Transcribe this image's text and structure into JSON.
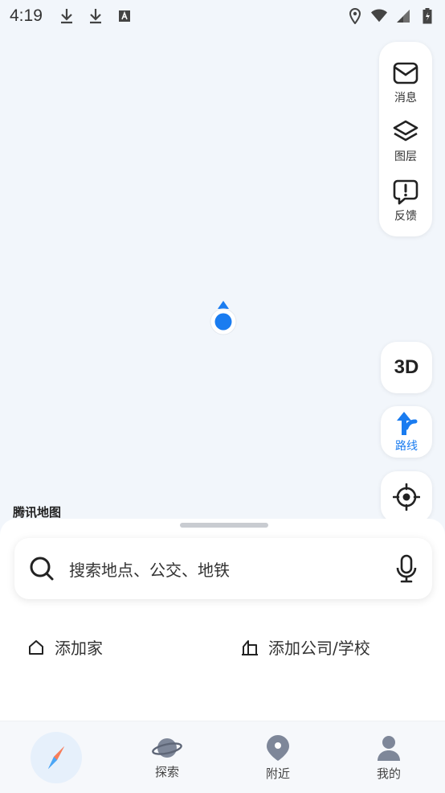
{
  "status_bar": {
    "time": "4:19"
  },
  "map": {
    "brand": "腾讯地图"
  },
  "right_panel": {
    "items": [
      {
        "label": "消息",
        "icon": "mail-icon"
      },
      {
        "label": "图层",
        "icon": "layers-icon"
      },
      {
        "label": "反馈",
        "icon": "feedback-icon"
      }
    ]
  },
  "controls": {
    "three_d_label": "3D",
    "route_label": "路线"
  },
  "search": {
    "placeholder": "搜索地点、公交、地铁"
  },
  "shortcuts": {
    "home_label": "添加家",
    "company_label": "添加公司/学校"
  },
  "tab_bar": {
    "items": [
      {
        "label": "",
        "icon": "compass-icon"
      },
      {
        "label": "探索",
        "icon": "planet-icon"
      },
      {
        "label": "附近",
        "icon": "pin-icon"
      },
      {
        "label": "我的",
        "icon": "user-icon"
      }
    ]
  },
  "colors": {
    "accent": "#1a7cf0",
    "map_bg": "#f2f6fb"
  }
}
